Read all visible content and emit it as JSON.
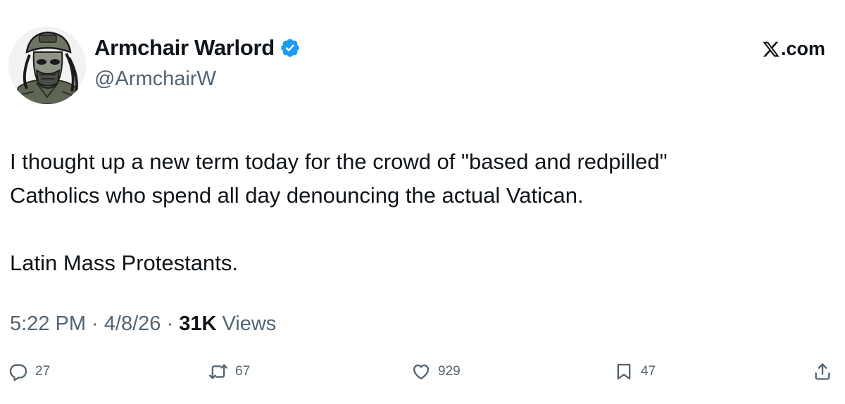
{
  "author": {
    "name": "Armchair Warlord",
    "handle": "@ArmchairW",
    "verified": true
  },
  "brand": {
    "label": ".com",
    "icon": "x-logo-icon"
  },
  "tweet": {
    "lines": [
      "I thought up a new term today for the crowd of \"based and redpilled\"",
      "Catholics who spend all day denouncing the actual Vatican.",
      "Latin Mass Protestants."
    ]
  },
  "meta": {
    "time": "5:22 PM",
    "separator": " · ",
    "date": "4/8/26",
    "views_count": "31K",
    "views_label": " Views"
  },
  "actions": {
    "reply": {
      "icon": "reply-icon",
      "count": "27"
    },
    "retweet": {
      "icon": "retweet-icon",
      "count": "67"
    },
    "like": {
      "icon": "heart-icon",
      "count": "929"
    },
    "bookmark": {
      "icon": "bookmark-icon",
      "count": "47"
    },
    "share": {
      "icon": "share-icon"
    }
  },
  "colors": {
    "text": "#0f1419",
    "secondary": "#536471",
    "verified": "#1d9bf0"
  }
}
